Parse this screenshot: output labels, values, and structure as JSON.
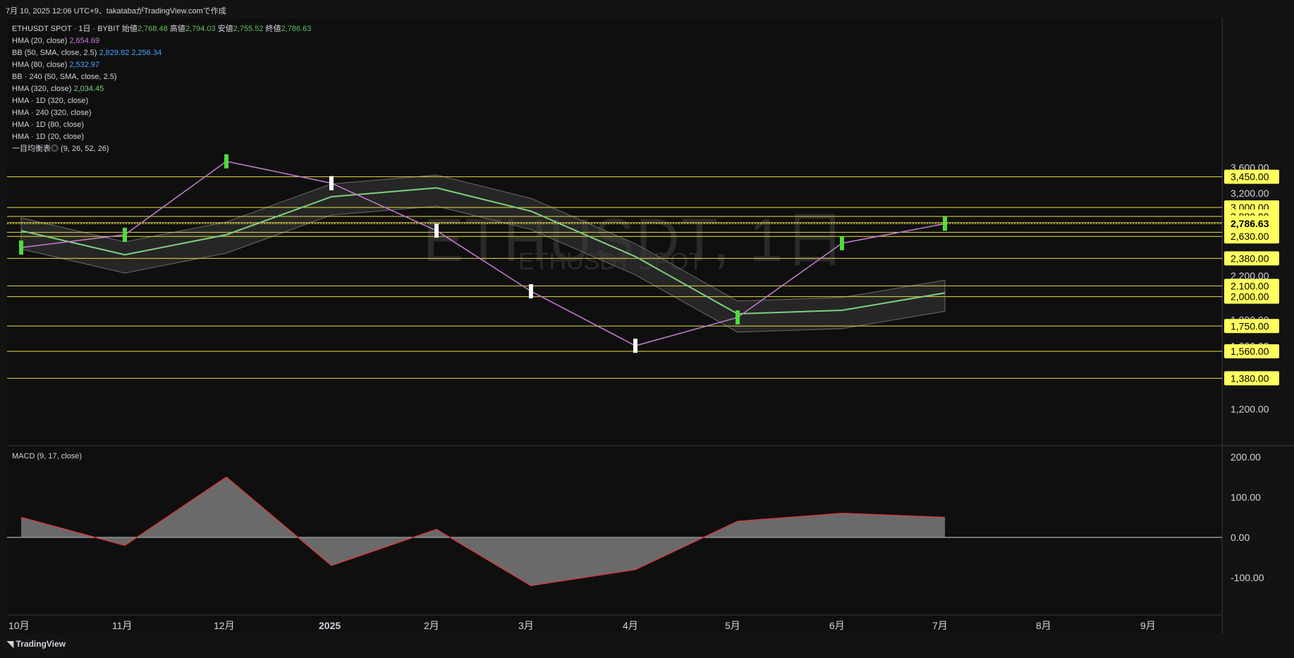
{
  "header": {
    "caption": "7月 10, 2025 12:06 UTC+9、takatabaがTradingView.comで作成"
  },
  "legend": {
    "title": "ETHUSDT SPOT · 1日 · BYBIT",
    "ohlc": {
      "open_label": "始値",
      "open": "2,768.48",
      "high_label": "高値",
      "high": "2,794.03",
      "low_label": "安値",
      "low": "2,755.52",
      "close_label": "終値",
      "close": "2,786.63"
    },
    "indicators": [
      {
        "name": "HMA (20, close)",
        "value": "2,654.69",
        "color": "#c77dd4"
      },
      {
        "name": "BB (50, SMA, close, 2.5)",
        "value": "2,829.82  2,256.34",
        "color": "#4aa3ff"
      },
      {
        "name": "HMA (80, close)",
        "value": "2,532.97",
        "color": "#4aa3ff"
      },
      {
        "name": "BB · 240 (50, SMA, close, 2.5)",
        "value": "",
        "color": "#4aa3ff"
      },
      {
        "name": "HMA (320, close)",
        "value": "2,034.45",
        "color": "#7fd17f"
      },
      {
        "name": "HMA · 1D (320, close)",
        "value": "",
        "color": ""
      },
      {
        "name": "HMA · 240 (320, close)",
        "value": "",
        "color": ""
      },
      {
        "name": "HMA · 1D (80, close)",
        "value": "",
        "color": ""
      },
      {
        "name": "HMA · 1D (20, close)",
        "value": "",
        "color": ""
      },
      {
        "name": "一目均衡表◎ (9, 26, 52, 26)",
        "value": "",
        "color": ""
      }
    ],
    "macd_label": "MACD (9, 17, close)"
  },
  "watermark": {
    "symbol": "ETHUSDT, 1日",
    "sub": "ETHUSDT SPOT"
  },
  "footer": {
    "brand": "TradingView"
  },
  "colors": {
    "up": "#4ddc3c",
    "down": "#ffffff",
    "hline": "#e8d94a",
    "hma20": "#c77dd4",
    "hma80": "#4aa3ff",
    "hma320": "#7fd17f",
    "bb": "#3a7fd6",
    "cloud": "#3a3a3a",
    "price_badge": "#ffff60"
  },
  "chart_data": {
    "type": "line",
    "title": "ETHUSDT SPOT · 1日 · BYBIT",
    "price_axis_ticks": [
      "3,600.00",
      "3,200.00",
      "2,200.00",
      "1,800.00",
      "1,600.00",
      "1,200.00"
    ],
    "time_axis": [
      "10月",
      "11月",
      "12月",
      "2025",
      "2月",
      "3月",
      "4月",
      "5月",
      "6月",
      "7月",
      "8月",
      "9月"
    ],
    "horizontal_levels": [
      "3,450.00",
      "3,000.00",
      "2,880.00",
      "2,800.00",
      "2,680.00",
      "2,630.00",
      "2,380.00",
      "2,100.00",
      "2,000.00",
      "1,750.00",
      "1,560.00",
      "1,380.00"
    ],
    "last_price": "2,786.63",
    "ylim": [
      1100,
      3800
    ],
    "series": [
      {
        "name": "ETHUSDT",
        "x": [
          "2024-10",
          "2024-11",
          "2024-12",
          "2025-01",
          "2025-02",
          "2025-03",
          "2025-04",
          "2025-05",
          "2025-06",
          "2025-07"
        ],
        "values": [
          2500,
          2650,
          3700,
          3350,
          2700,
          2050,
          1600,
          1820,
          2550,
          2786
        ]
      },
      {
        "name": "HMA (320, close)",
        "x": [
          "2024-10",
          "2024-11",
          "2024-12",
          "2025-01",
          "2025-02",
          "2025-03",
          "2025-04",
          "2025-05",
          "2025-06",
          "2025-07"
        ],
        "values": [
          2700,
          2420,
          2650,
          3150,
          3280,
          2950,
          2400,
          1850,
          1880,
          2034
        ]
      }
    ],
    "macd": {
      "label": "MACD (9, 17, close)",
      "ticks": [
        "200.00",
        "100.00",
        "0.00",
        "-100.00"
      ],
      "ylim": [
        -150,
        210
      ],
      "x": [
        "2024-10",
        "2024-11",
        "2024-12",
        "2025-01",
        "2025-02",
        "2025-03",
        "2025-04",
        "2025-05",
        "2025-06",
        "2025-07"
      ],
      "values": [
        50,
        -20,
        150,
        -70,
        20,
        -120,
        -80,
        40,
        60,
        50
      ]
    }
  }
}
